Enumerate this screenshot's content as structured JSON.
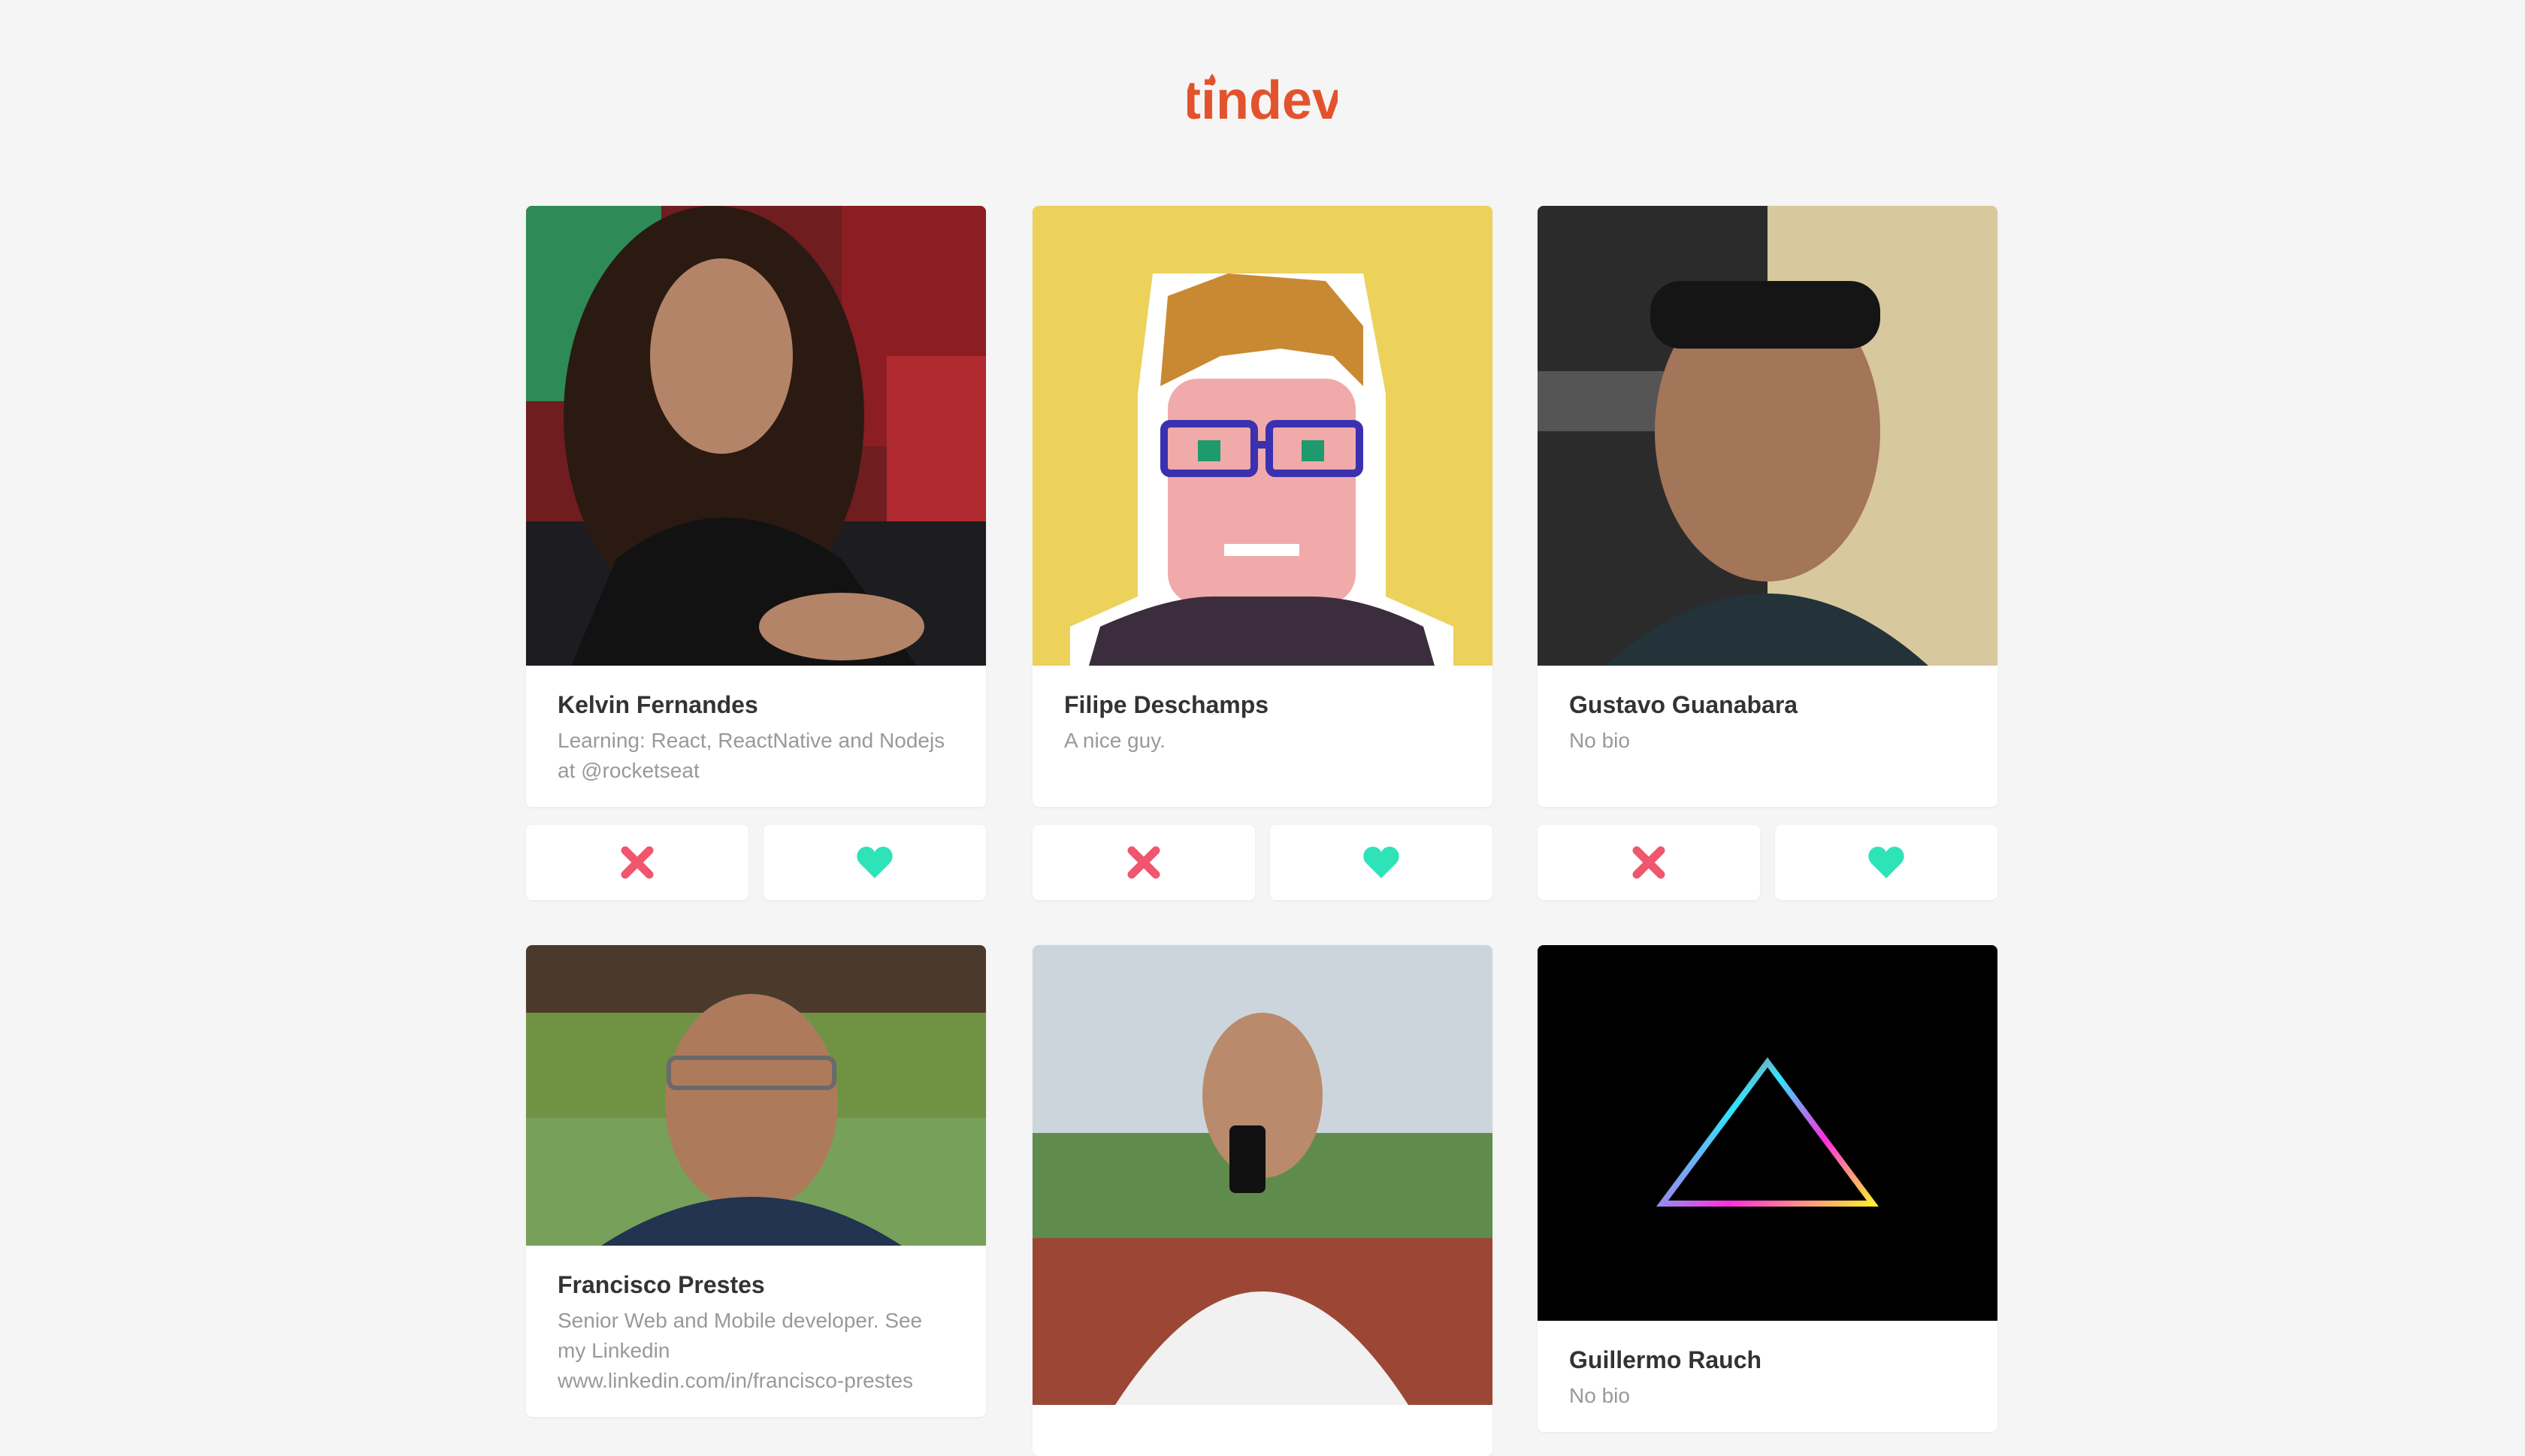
{
  "app": {
    "logo_text": "tindev",
    "brand_color": "#e2532d"
  },
  "colors": {
    "dislike": "#df4723",
    "like": "#2fe3b9",
    "page_bg": "#f5f5f5"
  },
  "devs": [
    {
      "name": "Kelvin Fernandes",
      "bio": "Learning: React, ReactNative and Nodejs at @rocketseat",
      "avatar": "photo-long-curly-hair-person"
    },
    {
      "name": "Filipe Deschamps",
      "bio": "A nice guy.",
      "avatar": "pixel-art-avatar-glasses"
    },
    {
      "name": "Gustavo Guanabara",
      "bio": "No bio",
      "avatar": "photo-split-face"
    },
    {
      "name": "Francisco Prestes",
      "bio": "Senior Web and Mobile developer. See my Linkedin www.linkedin.com/in/francisco-prestes",
      "avatar": "photo-man-glasses"
    },
    {
      "name": "",
      "bio": "",
      "avatar": "photo-man-white-shirt-selfie"
    },
    {
      "name": "Guillermo Rauch",
      "bio": "No bio",
      "avatar": "rainbow-triangle"
    }
  ],
  "actions": {
    "dislike_icon": "close-icon",
    "like_icon": "heart-icon"
  }
}
